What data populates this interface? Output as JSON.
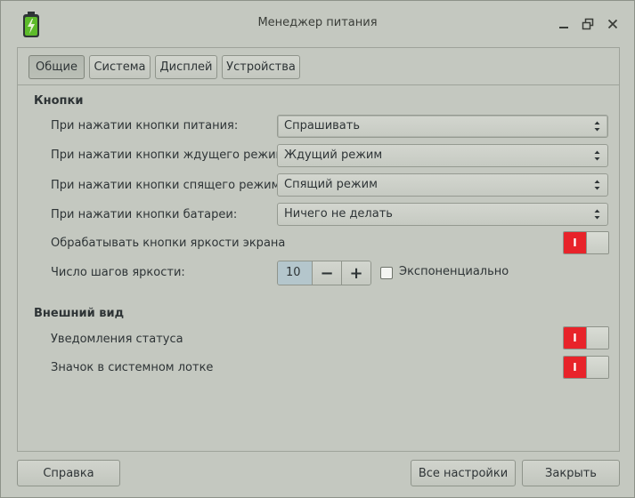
{
  "window": {
    "title": "Менеджер питания",
    "icon": "battery-charging-icon"
  },
  "tabs": [
    {
      "label": "Общие",
      "active": true
    },
    {
      "label": "Система",
      "active": false
    },
    {
      "label": "Дисплей",
      "active": false
    },
    {
      "label": "Устройства",
      "active": false
    }
  ],
  "buttons_section": {
    "title": "Кнопки",
    "power_button": {
      "label": "При нажатии кнопки питания:",
      "value": "Спрашивать"
    },
    "sleep_button": {
      "label": "При нажатии кнопки ждущего режима:",
      "value": "Ждущий режим"
    },
    "hibernate_button": {
      "label": "При нажатии кнопки спящего режима:",
      "value": "Спящий режим"
    },
    "battery_button": {
      "label": "При нажатии кнопки батареи:",
      "value": "Ничего не делать"
    },
    "brightness_keys": {
      "label": "Обрабатывать кнопки яркости экрана",
      "on": true,
      "on_glyph": "I"
    },
    "brightness_steps": {
      "label": "Число шагов яркости:",
      "value": "10",
      "minus": "−",
      "plus": "+"
    },
    "exponential": {
      "label": "Экспоненциально",
      "checked": false
    }
  },
  "appearance_section": {
    "title": "Внешний вид",
    "status_notifications": {
      "label": "Уведомления статуса",
      "on": true,
      "on_glyph": "I"
    },
    "tray_icon": {
      "label": "Значок в системном лотке",
      "on": true,
      "on_glyph": "I"
    }
  },
  "footer": {
    "help": "Справка",
    "all_settings": "Все настройки",
    "close": "Закрыть"
  },
  "colors": {
    "switch_on": "#e8232a",
    "spin_value_bg": "#b4c6cc",
    "window_bg": "#c4c8c0"
  }
}
